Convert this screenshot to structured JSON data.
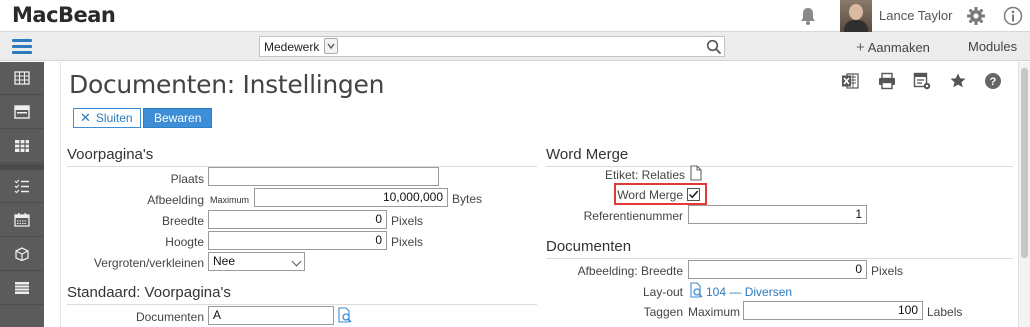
{
  "topbar": {
    "brand": "MacBean",
    "user_name": "Lance Taylor",
    "icons": [
      "bell-icon",
      "gear-icon",
      "info-icon"
    ]
  },
  "subbar": {
    "search_scope": "Medewerk",
    "search_placeholder": "",
    "create_label": "Aanmaken",
    "modules_label": "Modules"
  },
  "sidebar": {
    "items": [
      "calendar-grid-icon",
      "card-icon",
      "table-icon",
      "checklist-icon",
      "calendar-icon",
      "box-icon",
      "list-icon"
    ]
  },
  "page": {
    "title": "Documenten: Instellingen",
    "toolbar_icons": [
      "excel-icon",
      "print-icon",
      "settings-list-icon",
      "star-icon",
      "help-icon"
    ],
    "close_label": "Sluiten",
    "save_label": "Bewaren"
  },
  "voorpagina": {
    "title": "Voorpagina's",
    "plaats_label": "Plaats",
    "plaats_value": "",
    "afbeelding_label": "Afbeelding",
    "afbeelding_prefix": "Maximum",
    "afbeelding_value": "10,000,000",
    "afbeelding_unit": "Bytes",
    "breedte_label": "Breedte",
    "breedte_value": "0",
    "breedte_unit": "Pixels",
    "hoogte_label": "Hoogte",
    "hoogte_value": "0",
    "hoogte_unit": "Pixels",
    "vergroten_label": "Vergroten/verkleinen",
    "vergroten_value": "Nee"
  },
  "standaard": {
    "title": "Standaard: Voorpagina's",
    "documenten_label": "Documenten",
    "documenten_value": "A"
  },
  "wordmerge": {
    "title": "Word Merge",
    "etiket_label": "Etiket: Relaties",
    "wordmerge_label": "Word Merge",
    "wordmerge_checked": true,
    "referentie_label": "Referentienummer",
    "referentie_value": "1"
  },
  "documenten": {
    "title": "Documenten",
    "afbeelding_breedte_label": "Afbeelding: Breedte",
    "afbeelding_breedte_value": "0",
    "afbeelding_breedte_unit": "Pixels",
    "layout_label": "Lay-out",
    "layout_value": "104 — Diversen",
    "taggen_label": "Taggen",
    "taggen_prefix": "Maximum",
    "taggen_value": "100",
    "taggen_unit": "Labels"
  },
  "colors": {
    "accent": "#3d8ed6",
    "sidebar": "#5b5b5b",
    "highlight": "#e23a3a"
  }
}
